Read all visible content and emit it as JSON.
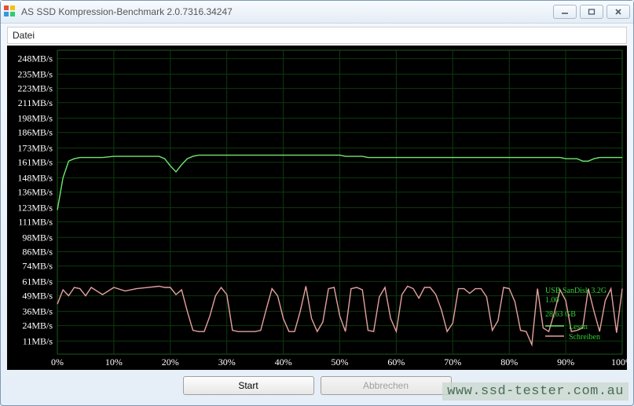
{
  "window": {
    "title": "AS SSD Kompression-Benchmark 2.0.7316.34247"
  },
  "menubar": {
    "file": "Datei"
  },
  "buttons": {
    "start": "Start",
    "cancel": "Abbrechen"
  },
  "legend": {
    "device": "USB  SanDisk 3.2G",
    "version": "1.00",
    "capacity": "28,63 GB",
    "read": "Lesen",
    "write": "Schreiben"
  },
  "watermark": "www.ssd-tester.com.au",
  "chart_data": {
    "type": "line",
    "xlabel": "",
    "ylabel": "",
    "xlim": [
      0,
      100
    ],
    "ylim": [
      0,
      255
    ],
    "x_ticks": [
      "0%",
      "10%",
      "20%",
      "30%",
      "40%",
      "50%",
      "60%",
      "70%",
      "80%",
      "90%",
      "100%"
    ],
    "y_ticks": [
      "11MB/s",
      "24MB/s",
      "36MB/s",
      "49MB/s",
      "61MB/s",
      "74MB/s",
      "86MB/s",
      "98MB/s",
      "111MB/s",
      "123MB/s",
      "136MB/s",
      "148MB/s",
      "161MB/s",
      "173MB/s",
      "186MB/s",
      "198MB/s",
      "211MB/s",
      "223MB/s",
      "235MB/s",
      "248MB/s"
    ],
    "x": [
      0,
      1,
      2,
      3,
      4,
      5,
      6,
      8,
      10,
      12,
      14,
      16,
      18,
      19,
      20,
      21,
      22,
      23,
      24,
      25,
      26,
      27,
      28,
      29,
      30,
      31,
      32,
      33,
      34,
      35,
      36,
      37,
      38,
      39,
      40,
      41,
      42,
      43,
      44,
      45,
      46,
      47,
      48,
      49,
      50,
      51,
      52,
      53,
      54,
      55,
      56,
      57,
      58,
      59,
      60,
      61,
      62,
      63,
      64,
      65,
      66,
      67,
      68,
      69,
      70,
      71,
      72,
      73,
      74,
      75,
      76,
      77,
      78,
      79,
      80,
      81,
      82,
      83,
      84,
      85,
      86,
      87,
      88,
      89,
      90,
      91,
      92,
      93,
      94,
      95,
      96,
      97,
      98,
      99,
      100
    ],
    "series": [
      {
        "name": "Lesen",
        "color": "#6fe86f",
        "values": [
          121,
          148,
          162,
          164,
          165,
          165,
          165,
          165,
          166,
          166,
          166,
          166,
          166,
          164,
          158,
          153,
          159,
          164,
          166,
          167,
          167,
          167,
          167,
          167,
          167,
          167,
          167,
          167,
          167,
          167,
          167,
          167,
          167,
          167,
          167,
          167,
          167,
          167,
          167,
          167,
          167,
          167,
          167,
          167,
          167,
          166,
          166,
          166,
          166,
          165,
          165,
          165,
          165,
          165,
          165,
          165,
          165,
          165,
          165,
          165,
          165,
          165,
          165,
          165,
          165,
          165,
          165,
          165,
          165,
          165,
          165,
          165,
          165,
          165,
          165,
          165,
          165,
          165,
          165,
          165,
          165,
          165,
          165,
          165,
          164,
          164,
          164,
          162,
          162,
          164,
          165,
          165,
          165,
          165,
          165
        ]
      },
      {
        "name": "Schreiben",
        "color": "#e6a0a0",
        "values": [
          42,
          54,
          49,
          56,
          55,
          49,
          56,
          50,
          56,
          53,
          55,
          56,
          57,
          56,
          56,
          50,
          54,
          36,
          20,
          19,
          19,
          32,
          49,
          56,
          50,
          20,
          19,
          19,
          19,
          19,
          20,
          38,
          55,
          49,
          30,
          19,
          19,
          36,
          57,
          30,
          19,
          27,
          55,
          56,
          32,
          19,
          55,
          56,
          54,
          20,
          19,
          48,
          56,
          30,
          19,
          50,
          57,
          55,
          47,
          56,
          56,
          50,
          37,
          19,
          26,
          55,
          55,
          51,
          55,
          55,
          48,
          20,
          28,
          56,
          55,
          44,
          20,
          19,
          8,
          55,
          22,
          19,
          35,
          54,
          45,
          19,
          20,
          22,
          55,
          36,
          19,
          45,
          55,
          18,
          55
        ]
      }
    ]
  }
}
